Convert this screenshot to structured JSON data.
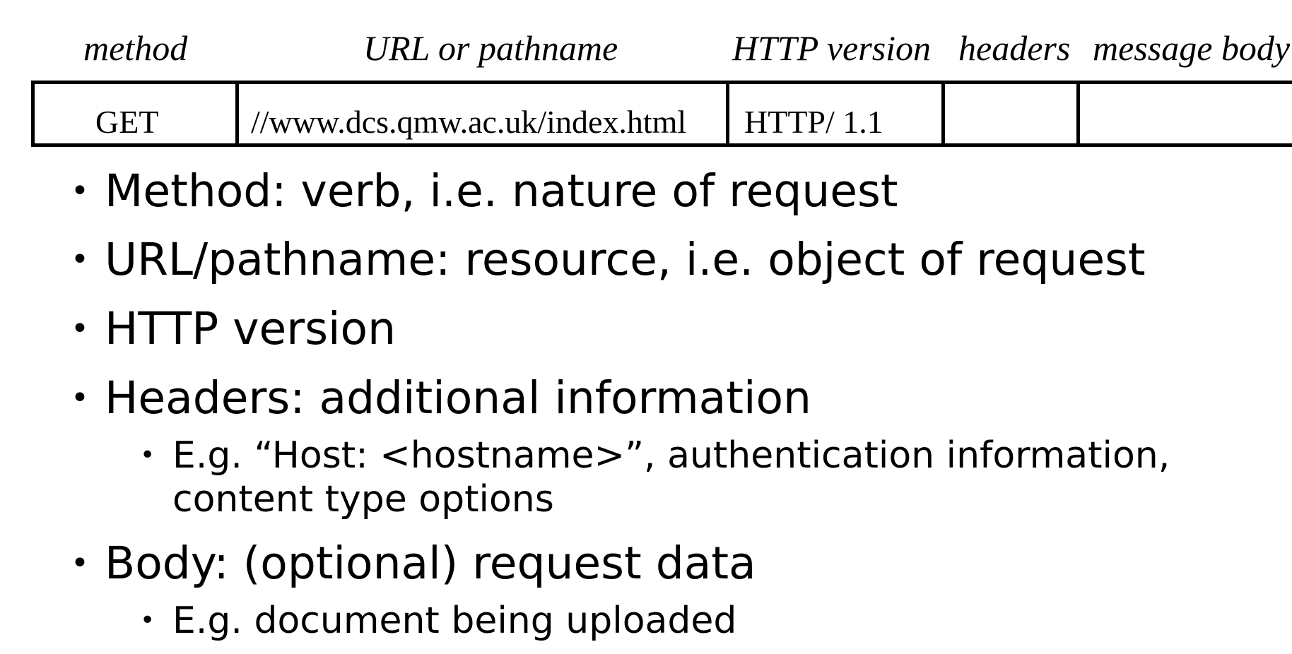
{
  "table": {
    "column_headers": {
      "method": "method",
      "url": "URL or pathname",
      "version": "HTTP version",
      "headers": "headers",
      "body": "message body"
    },
    "cells": {
      "method": "GET",
      "url": "//www.dcs.qmw.ac.uk/index.html",
      "version": "HTTP/ 1.1",
      "headers": "",
      "body": ""
    }
  },
  "bullets": [
    {
      "text": "Method: verb, i.e. nature of request"
    },
    {
      "text": "URL/pathname: resource, i.e. object of request"
    },
    {
      "text": "HTTP version"
    },
    {
      "text": "Headers: additional information",
      "sub": [
        {
          "line1": "E.g. “Host: <hostname>”, authentication information,",
          "line2": "content type options"
        }
      ]
    },
    {
      "text": "Body: (optional) request data",
      "sub": [
        {
          "line1": "E.g. document being uploaded"
        }
      ]
    }
  ],
  "bullet_glyph": "•"
}
